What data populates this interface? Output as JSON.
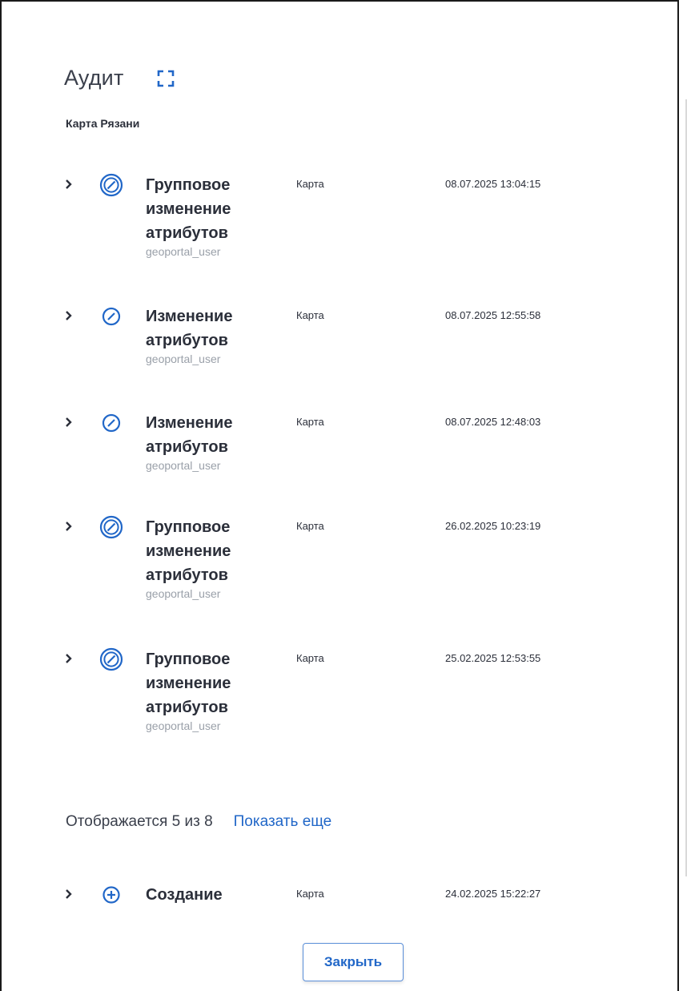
{
  "header": {
    "title": "Аудит"
  },
  "subtitle": "Карта Рязани",
  "rows": [
    {
      "action": "Групповое изменение атрибутов",
      "user": "geoportal_user",
      "object": "Карта",
      "datetime": "08.07.2025 13:04:15",
      "icon": "group-edit-icon"
    },
    {
      "action": "Изменение атрибутов",
      "user": "geoportal_user",
      "object": "Карта",
      "datetime": "08.07.2025 12:55:58",
      "icon": "edit-icon"
    },
    {
      "action": "Изменение атрибутов",
      "user": "geoportal_user",
      "object": "Карта",
      "datetime": "08.07.2025 12:48:03",
      "icon": "edit-icon"
    },
    {
      "action": "Групповое изменение атрибутов",
      "user": "geoportal_user",
      "object": "Карта",
      "datetime": "26.02.2025 10:23:19",
      "icon": "group-edit-icon"
    },
    {
      "action": "Групповое изменение атрибутов",
      "user": "geoportal_user",
      "object": "Карта",
      "datetime": "25.02.2025 12:53:55",
      "icon": "group-edit-icon"
    }
  ],
  "pagination": {
    "shown_text": "Отображается 5 из 8",
    "more_label": "Показать еще"
  },
  "extra_row": {
    "action": "Создание",
    "object": "Карта",
    "datetime": "24.02.2025 15:22:27",
    "icon": "plus-circle-icon"
  },
  "footer": {
    "close_label": "Закрыть"
  },
  "colors": {
    "accent": "#2167c8",
    "text": "#2b2f3a",
    "muted": "#9aa0a9"
  }
}
